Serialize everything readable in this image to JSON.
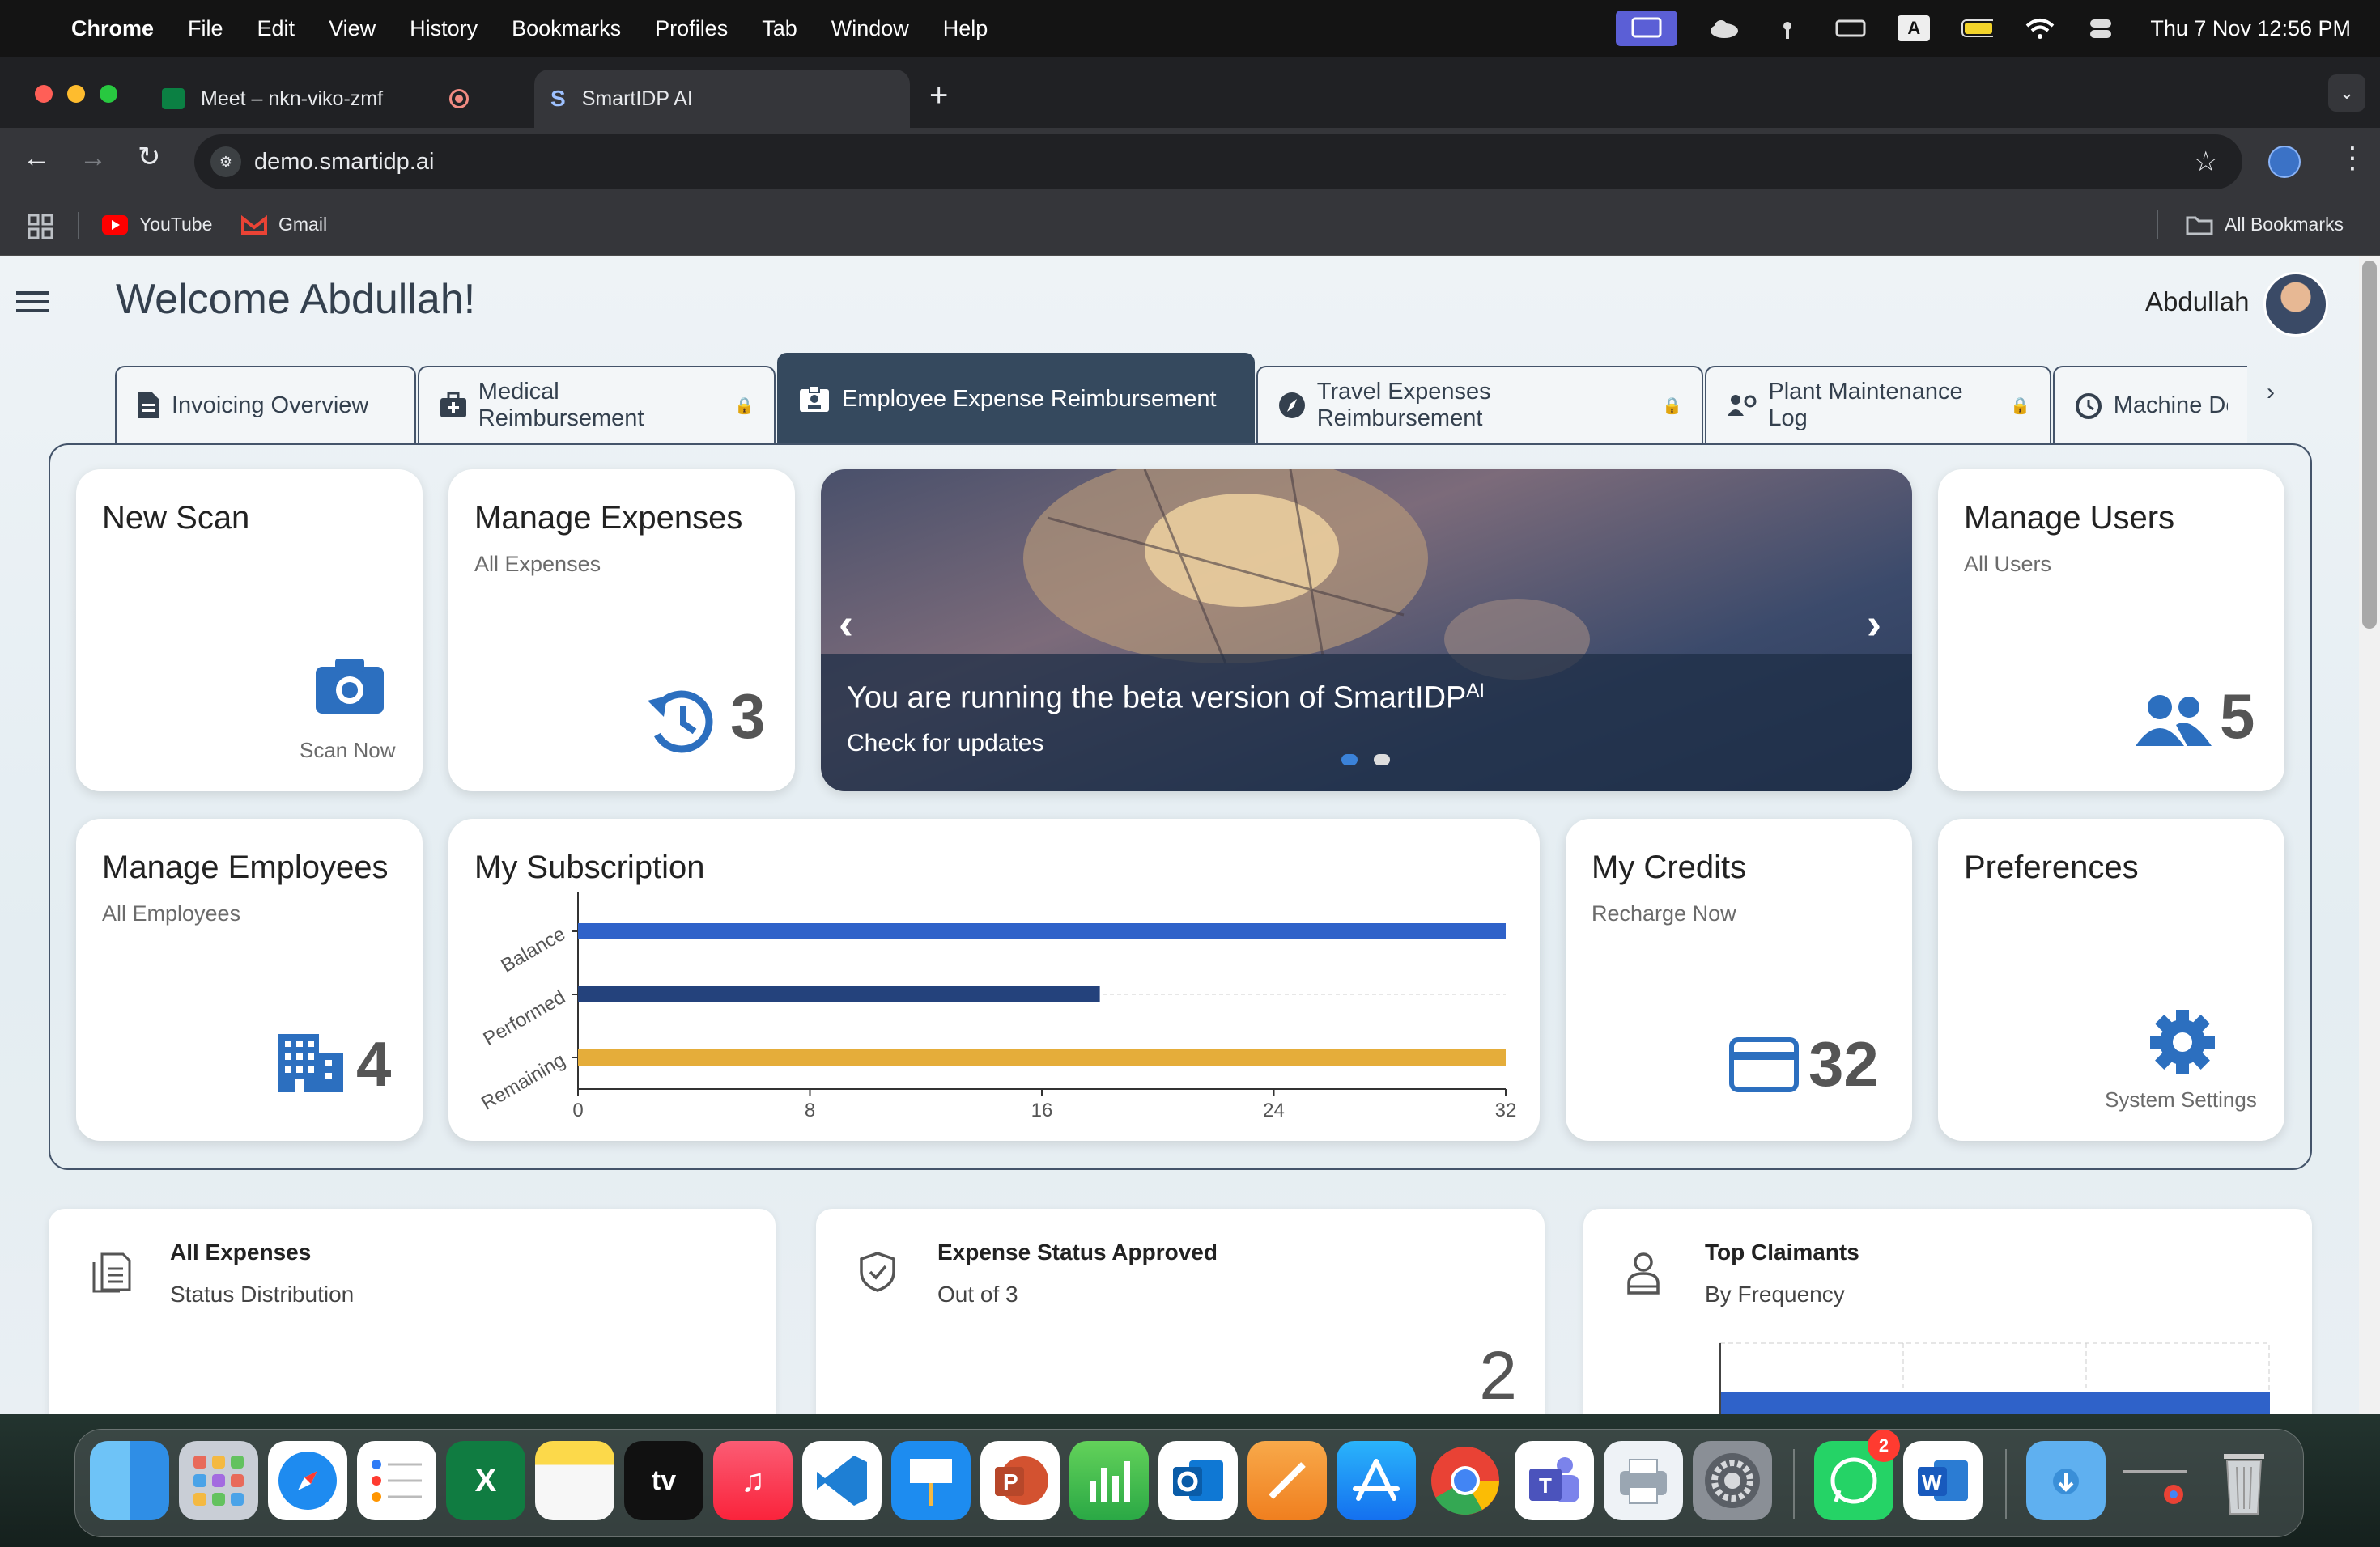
{
  "menubar": {
    "app": "Chrome",
    "items": [
      "File",
      "Edit",
      "View",
      "History",
      "Bookmarks",
      "Profiles",
      "Tab",
      "Window",
      "Help"
    ],
    "clock": "Thu 7 Nov  12:56 PM",
    "input_badge": "A"
  },
  "browser": {
    "tabs": [
      {
        "title": "Meet – nkn-viko-zmf"
      },
      {
        "title": "SmartIDP AI"
      }
    ],
    "url": "demo.smartidp.ai",
    "bookmarks": [
      "YouTube",
      "Gmail"
    ],
    "all_bookmarks": "All Bookmarks"
  },
  "header": {
    "welcome": "Welcome Abdullah!",
    "user": "Abdullah"
  },
  "module_tabs": [
    {
      "label": "Invoicing Overview",
      "locked": false
    },
    {
      "label": "Medical Reimbursement",
      "locked": true
    },
    {
      "label": "Employee Expense Reimbursement",
      "locked": false,
      "selected": true
    },
    {
      "label": "Travel Expenses Reimbursement",
      "locked": true
    },
    {
      "label": "Plant Maintenance Log",
      "locked": true
    },
    {
      "label": "Machine Do",
      "locked": false
    }
  ],
  "cards": {
    "new_scan": {
      "title": "New Scan",
      "action": "Scan Now"
    },
    "manage_expenses": {
      "title": "Manage Expenses",
      "subtitle": "All Expenses",
      "count": "3"
    },
    "banner": {
      "text": "You are running the beta version of SmartIDP",
      "sup": "AI",
      "link": "Check for updates"
    },
    "manage_users": {
      "title": "Manage Users",
      "subtitle": "All Users",
      "count": "5"
    },
    "manage_employees": {
      "title": "Manage Employees",
      "subtitle": "All Employees",
      "count": "4"
    },
    "subscription": {
      "title": "My Subscription"
    },
    "credits": {
      "title": "My Credits",
      "subtitle": "Recharge Now",
      "count": "32"
    },
    "preferences": {
      "title": "Preferences",
      "action": "System Settings"
    }
  },
  "bottom_cards": [
    {
      "title": "All Expenses",
      "subtitle": "Status Distribution"
    },
    {
      "title": "Expense Status Approved",
      "subtitle": "Out of 3",
      "value": "2"
    },
    {
      "title": "Top Claimants",
      "subtitle": "By Frequency"
    }
  ],
  "chart_data": {
    "type": "bar",
    "orientation": "horizontal",
    "categories": [
      "Balance",
      "Performed",
      "Remaining"
    ],
    "values": [
      32,
      18,
      32
    ],
    "colors": [
      "#2f62c9",
      "#24427c",
      "#e5ad3a"
    ],
    "xlim": [
      0,
      32
    ],
    "xticks": [
      "0",
      "8",
      "16",
      "24",
      "32"
    ],
    "grid": true
  },
  "dock": {
    "whatsapp_badge": "2"
  }
}
